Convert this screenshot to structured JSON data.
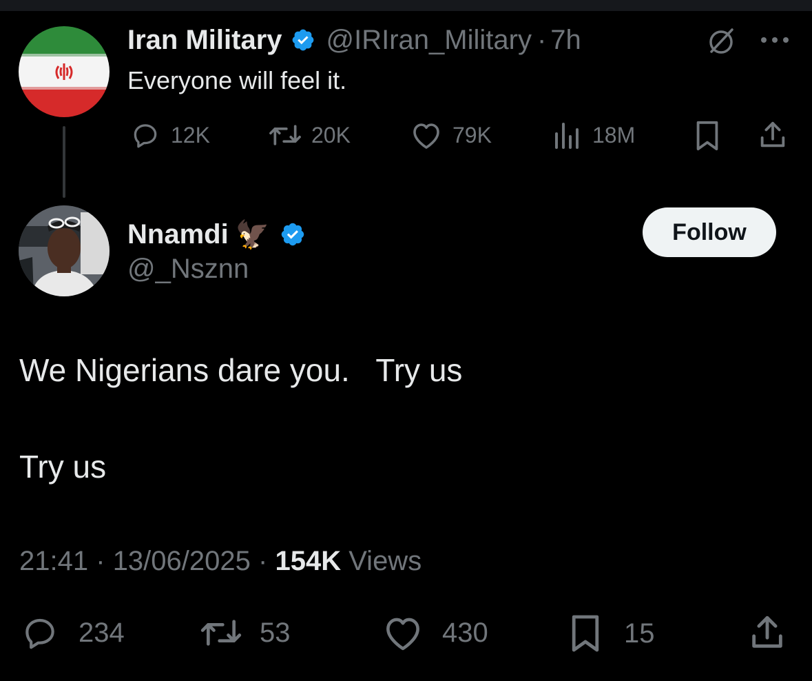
{
  "quoted_post": {
    "author_name": "Iran Military",
    "author_handle": "@IRIran_Military",
    "separator": "·",
    "time": "7h",
    "text": "Everyone will feel it.",
    "replies": "12K",
    "reposts": "20K",
    "likes": "79K",
    "views": "18M"
  },
  "post": {
    "author_name": "Nnamdi",
    "author_emoji": "🦅",
    "author_handle": "@_Nsznn",
    "follow_label": "Follow",
    "text_line1": "We Nigerians dare you.   Try us",
    "text_line2": "Try us",
    "time": "21:41",
    "separator": "·",
    "date": "13/06/2025",
    "views_count": "154K",
    "views_label": "Views",
    "replies": "234",
    "reposts": "53",
    "likes": "430",
    "bookmarks": "15"
  },
  "colors": {
    "background": "#000000",
    "text_primary": "#e7e9ea",
    "text_secondary": "#71767b",
    "verified_blue": "#1d9bf0",
    "follow_button_bg": "#eff3f4"
  },
  "icons": {
    "verified": "verified-badge-icon",
    "grok": "grok-icon",
    "more": "more-icon",
    "reply": "reply-icon",
    "repost": "repost-icon",
    "like": "like-icon",
    "views": "views-icon",
    "bookmark": "bookmark-icon",
    "share": "share-icon"
  }
}
